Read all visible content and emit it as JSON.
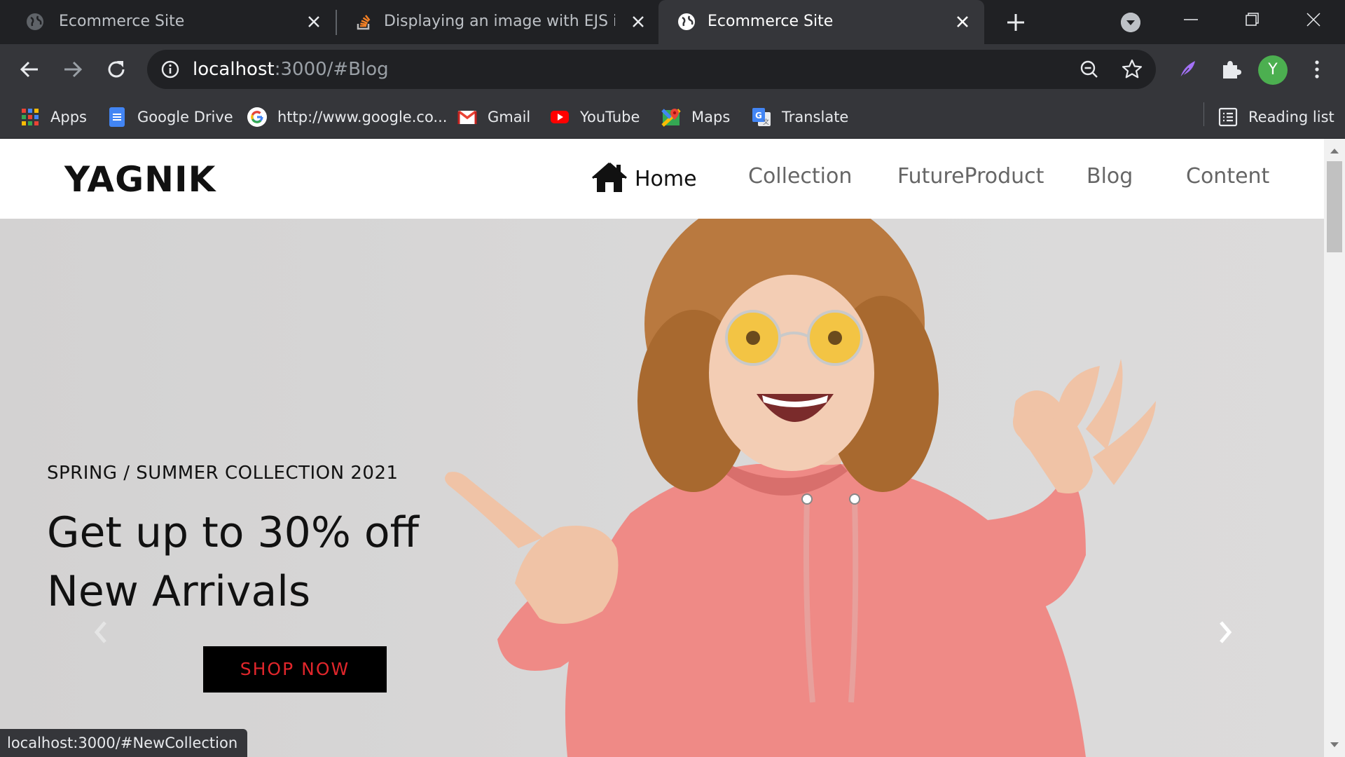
{
  "browser": {
    "tabs": [
      {
        "title": "Ecommerce Site",
        "icon": "globe-icon",
        "active": false
      },
      {
        "title": "Displaying an image with EJS in nod",
        "icon": "stackoverflow-icon",
        "active": false
      },
      {
        "title": "Ecommerce Site",
        "icon": "globe-icon",
        "active": true
      }
    ],
    "address": {
      "host": "localhost",
      "rest": ":3000/#Blog"
    },
    "profile_initial": "Y",
    "bookmarks": [
      {
        "label": "Apps",
        "icon": "apps-grid-icon"
      },
      {
        "label": "Google Drive",
        "icon": "google-docs-icon"
      },
      {
        "label": "http://www.google.co...",
        "icon": "google-icon"
      },
      {
        "label": "Gmail",
        "icon": "gmail-icon"
      },
      {
        "label": "YouTube",
        "icon": "youtube-icon"
      },
      {
        "label": "Maps",
        "icon": "maps-icon"
      },
      {
        "label": "Translate",
        "icon": "translate-icon"
      }
    ],
    "reading_list": "Reading list",
    "status_url": "localhost:3000/#NewCollection"
  },
  "site": {
    "brand": "YAGNIK",
    "nav": {
      "home": "Home",
      "links": [
        "Collection",
        "FutureProduct",
        "Blog",
        "Content"
      ]
    },
    "hero": {
      "kicker": "SPRING / SUMMER COLLECTION 2021",
      "headline_1": "Get up to 30% off",
      "headline_2": "New Arrivals",
      "cta": "SHOP NOW",
      "cta_color": "#e0262b"
    }
  },
  "colors": {
    "tabstrip": "#202124",
    "toolbar": "#35363a",
    "avatar": "#4caf50"
  }
}
